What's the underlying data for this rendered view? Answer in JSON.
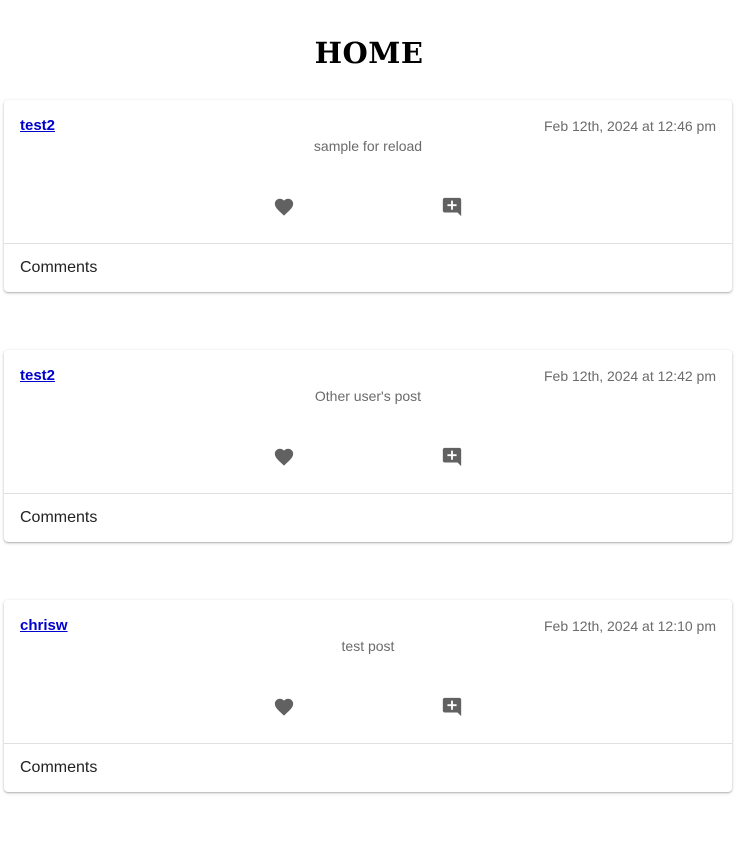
{
  "header": {
    "title": "HOME"
  },
  "posts": [
    {
      "author": "test2",
      "timestamp": "Feb 12th, 2024 at 12:46 pm",
      "body": "sample for reload",
      "comments_label": "Comments"
    },
    {
      "author": "test2",
      "timestamp": "Feb 12th, 2024 at 12:42 pm",
      "body": "Other user's post",
      "comments_label": "Comments"
    },
    {
      "author": "chrisw",
      "timestamp": "Feb 12th, 2024 at 12:10 pm",
      "body": "test post",
      "comments_label": "Comments"
    }
  ],
  "icons": {
    "like": "heart-icon",
    "comment": "add-comment-icon"
  },
  "colors": {
    "author_link": "#0000cc",
    "muted_text": "#6b6b6b",
    "icon": "#616161"
  }
}
